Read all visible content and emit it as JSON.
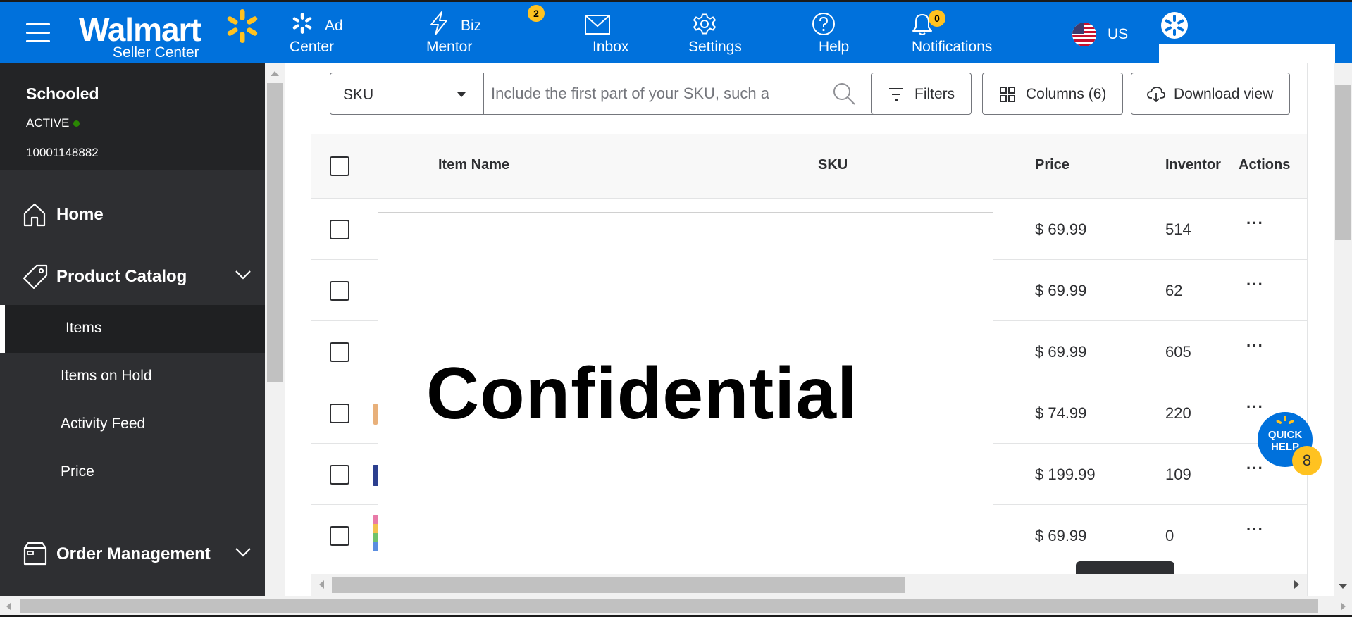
{
  "header": {
    "brand": "Walmart",
    "brand_sub": "Seller Center",
    "nav": [
      {
        "line1": "Ad",
        "line2": "Center",
        "icon": "spark-icon"
      },
      {
        "line1": "Biz",
        "line2": "Mentor",
        "icon": "lightning-icon",
        "badge": "2"
      },
      {
        "label": "Inbox",
        "icon": "mail-icon"
      },
      {
        "label": "Settings",
        "icon": "gear-icon"
      },
      {
        "label": "Help",
        "icon": "help-icon"
      },
      {
        "label": "Notifications",
        "icon": "bell-icon",
        "badge": "0"
      }
    ],
    "region": "US",
    "colors": {
      "bar": "#0071dc",
      "spark": "#ffc220"
    }
  },
  "sidebar": {
    "store_name": "Schooled",
    "status": "ACTIVE",
    "seller_id": "10001148882",
    "home": "Home",
    "product_catalog": "Product Catalog",
    "sub_items": [
      "Items",
      "Items on Hold",
      "Activity Feed",
      "Price"
    ],
    "order_management": "Order Management"
  },
  "toolbar": {
    "search_type": "SKU",
    "search_placeholder": "Include the first part of your SKU, such a",
    "filters": "Filters",
    "columns": "Columns (6)",
    "download": "Download view"
  },
  "table": {
    "columns": [
      "Item Name",
      "SKU",
      "Price",
      "Inventor",
      "Actions"
    ],
    "rows": [
      {
        "price": "$ 69.99",
        "inventory": "514"
      },
      {
        "price": "$ 69.99",
        "inventory": "62"
      },
      {
        "price": "$ 69.99",
        "inventory": "605"
      },
      {
        "price": "$ 74.99",
        "inventory": "220"
      },
      {
        "price": "$ 199.99",
        "inventory": "109"
      },
      {
        "price": "$ 69.99",
        "inventory": "0"
      }
    ],
    "actions_glyph": "···"
  },
  "overlay": {
    "text": "Confidential"
  },
  "quick_help": {
    "line1": "QUICK",
    "line2": "HELP",
    "count": "8"
  }
}
